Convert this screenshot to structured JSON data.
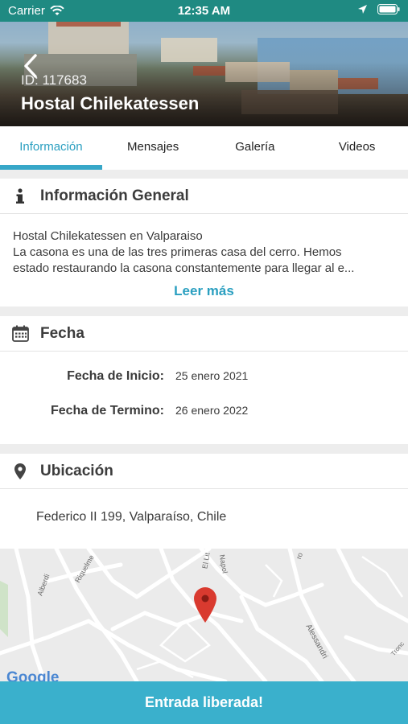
{
  "status_bar": {
    "carrier": "Carrier",
    "time": "12:35 AM"
  },
  "hero": {
    "id_label": "ID: 117683",
    "title": "Hostal Chilekatessen"
  },
  "tabs": [
    {
      "label": "Información",
      "active": true
    },
    {
      "label": "Mensajes",
      "active": false
    },
    {
      "label": "Galería",
      "active": false
    },
    {
      "label": "Videos",
      "active": false
    }
  ],
  "info": {
    "title": "Información General",
    "line1": "Hostal Chilekatessen en Valparaiso",
    "line2": "La casona es una de las tres primeras casa del cerro. Hemos",
    "line3": "estado restaurando la casona constantemente para llegar al e...",
    "more": "Leer más"
  },
  "fecha": {
    "title": "Fecha",
    "start_label": "Fecha de Inicio:",
    "start_value": "25 enero 2021",
    "end_label": "Fecha de Termino:",
    "end_value": "26 enero 2022"
  },
  "ubicacion": {
    "title": "Ubicación",
    "address": "Federico II 199, Valparaíso, Chile"
  },
  "map": {
    "streets": [
      "Alberdi",
      "Riquelme",
      "El Lit",
      "Napol",
      "ro",
      "Alessandri",
      "Tronc"
    ],
    "attribution": "Google"
  },
  "cta": {
    "label": "Entrada liberada!"
  },
  "colors": {
    "accent": "#37a7c8",
    "status_bar": "#1f8a82",
    "pin": "#d93a2f"
  }
}
